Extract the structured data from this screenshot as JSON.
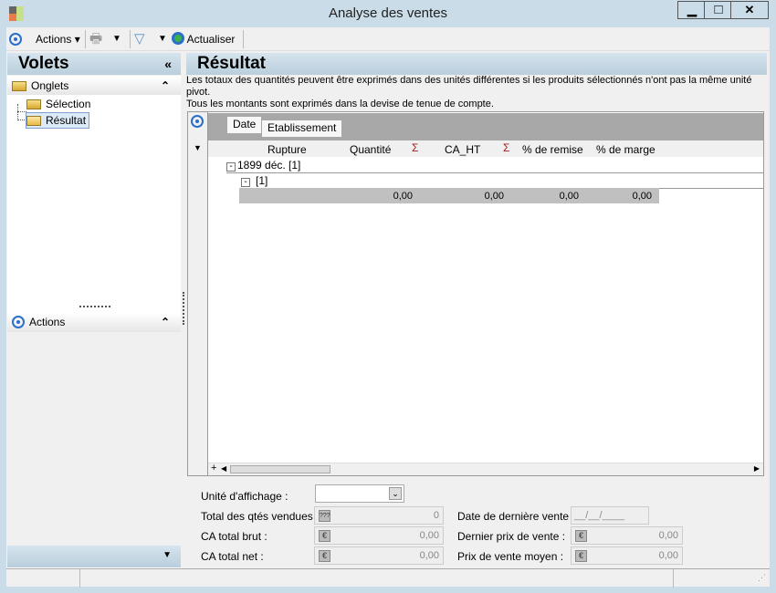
{
  "window": {
    "title": "Analyse des ventes",
    "min": "▁",
    "max": "□",
    "close": "✕"
  },
  "toolbar": {
    "actions": "Actions",
    "refresh": "Actualiser"
  },
  "left": {
    "title": "Volets",
    "collapse": "«",
    "onglets": "Onglets",
    "tree": [
      "Sélection",
      "Résultat"
    ],
    "actions": "Actions",
    "expand": "⌃"
  },
  "main": {
    "title": "Résultat",
    "info1": "Les totaux des quantités peuvent être exprimés dans des unités différentes si les produits sélectionnés n'ont pas la même unité pivot.",
    "info2": "Tous les montants sont exprimés dans la devise de tenue de compte.",
    "group_tabs": [
      "Date",
      "Etablissement"
    ],
    "columns": [
      "Rupture",
      "Quantité",
      "CA_HT",
      "% de remise",
      "% de marge"
    ],
    "sigma": "Σ",
    "group1": "1899 déc. [1]",
    "group2": "[1]",
    "totals": [
      "0,00",
      "0,00",
      "0,00",
      "0,00"
    ]
  },
  "summary": {
    "unit_label": "Unité d'affichage :",
    "qty_label": "Total des qtés vendues :",
    "qty_value": "0",
    "qty_icon": "???",
    "brut_label": "CA total brut :",
    "brut_value": "0,00",
    "net_label": "CA total net :",
    "net_value": "0,00",
    "last_date_label": "Date de dernière vente :",
    "last_date_value": "__/__/____",
    "last_price_label": "Dernier prix de vente :",
    "last_price_value": "0,00",
    "avg_price_label": "Prix de vente moyen :",
    "avg_price_value": "0,00",
    "currency": "€"
  }
}
